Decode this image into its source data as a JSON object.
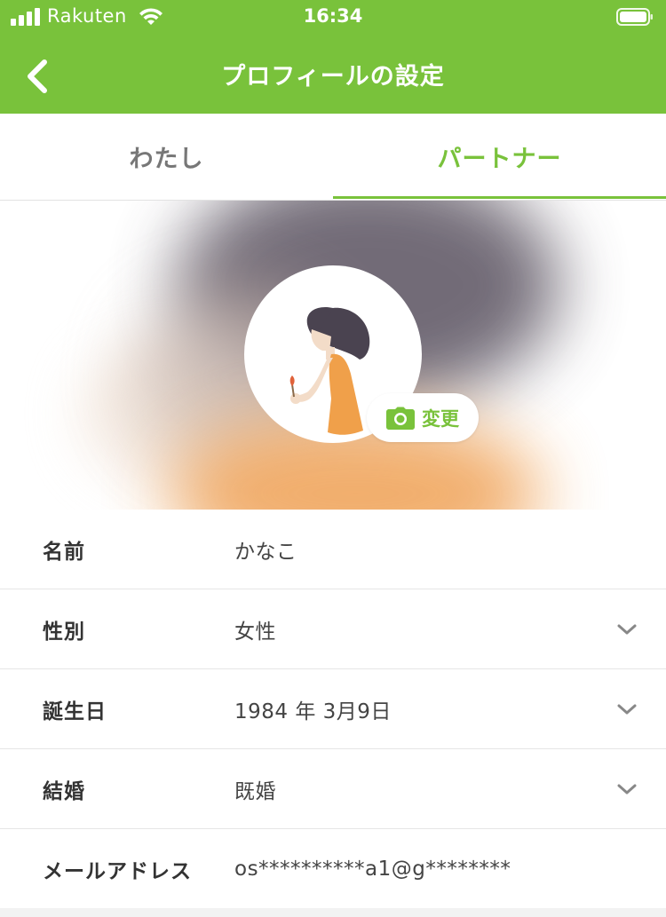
{
  "status_bar": {
    "carrier": "Rakuten",
    "time": "16:34",
    "signal_icon": "signal-bars-icon",
    "wifi_icon": "wifi-icon",
    "battery_icon": "battery-icon"
  },
  "nav": {
    "title": "プロフィールの設定",
    "back_icon": "chevron-left-icon"
  },
  "tabs": [
    {
      "label": "わたし",
      "active": false
    },
    {
      "label": "パートナー",
      "active": true
    }
  ],
  "profile": {
    "change_photo_label": "変更",
    "camera_icon": "camera-icon"
  },
  "fields": [
    {
      "label": "名前",
      "value": "かなこ",
      "dropdown": false
    },
    {
      "label": "性別",
      "value": "女性",
      "dropdown": true
    },
    {
      "label": "誕生日",
      "value": "1984 年 3月9日",
      "dropdown": true
    },
    {
      "label": "結婚",
      "value": "既婚",
      "dropdown": true
    },
    {
      "label": "メールアドレス",
      "value": "os**********a1@g********",
      "dropdown": false
    }
  ],
  "colors": {
    "accent": "#79c23b",
    "background": "#f2f2f2",
    "divider": "#e6e6e6"
  }
}
